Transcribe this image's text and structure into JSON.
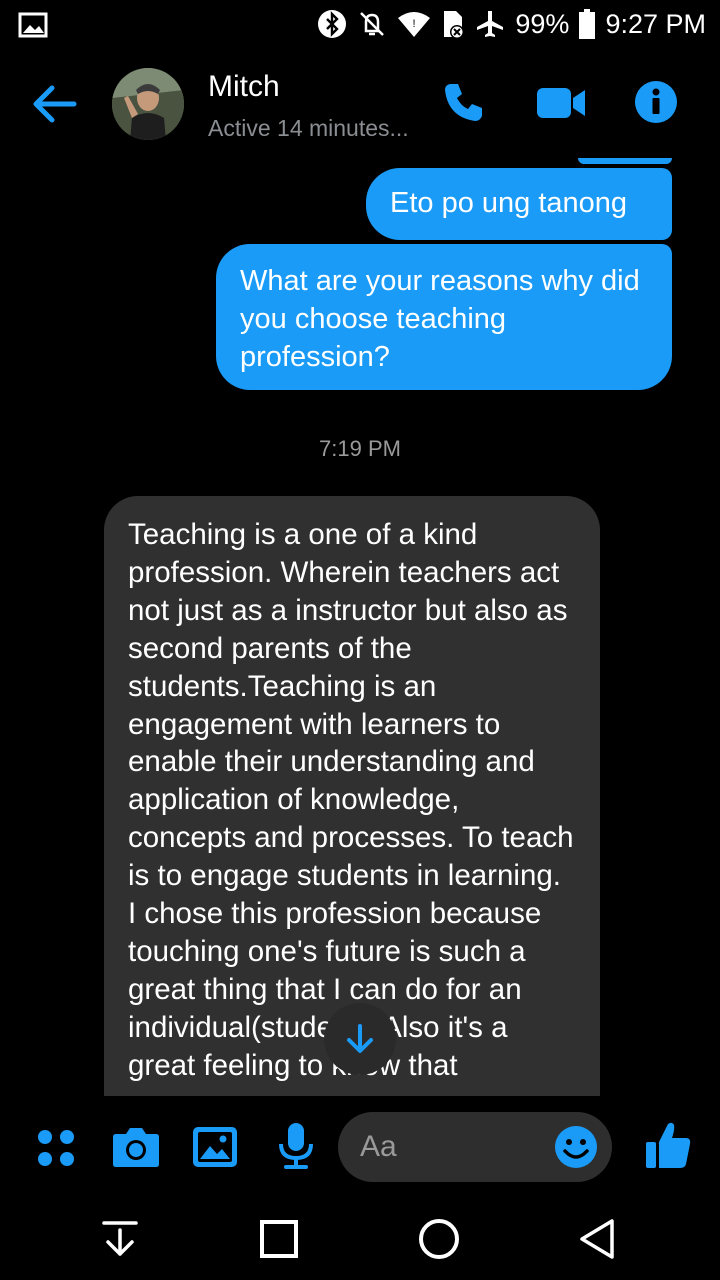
{
  "status_bar": {
    "battery": "99%",
    "time": "9:27 PM"
  },
  "header": {
    "name": "Mitch",
    "subtitle": "Active 14 minutes..."
  },
  "messages": {
    "out1": "Eto po ung tanong",
    "out2": "What are your reasons why did you choose teaching profession?",
    "timestamp": "7:19 PM",
    "in1": "Teaching is a one of a kind profession. Wherein teachers act not just as a instructor but also as second parents of the students.Teaching is an engagement with learners to enable their understanding and application of knowledge, concepts and processes. To teach is to engage students in learning. I chose this profession because touching one's future is such a great thing that I can do for an individual(student). Also it's a great feeling to know that"
  },
  "composer": {
    "placeholder": "Aa"
  },
  "colors": {
    "accent": "#1a9bf7",
    "incoming_bubble": "#303030",
    "background": "#000000"
  },
  "icons": {
    "status": [
      "gallery-icon",
      "bluetooth-icon",
      "mute-icon",
      "wifi-icon",
      "sim-icon",
      "airplane-icon",
      "battery-icon"
    ],
    "header": [
      "back-arrow-icon",
      "phone-icon",
      "video-icon",
      "info-icon"
    ],
    "composer": [
      "apps-icon",
      "camera-icon",
      "image-icon",
      "microphone-icon",
      "emoji-icon",
      "thumbs-up-icon"
    ],
    "nav": [
      "nav-down-icon",
      "recents-icon",
      "home-icon",
      "back-icon"
    ]
  }
}
